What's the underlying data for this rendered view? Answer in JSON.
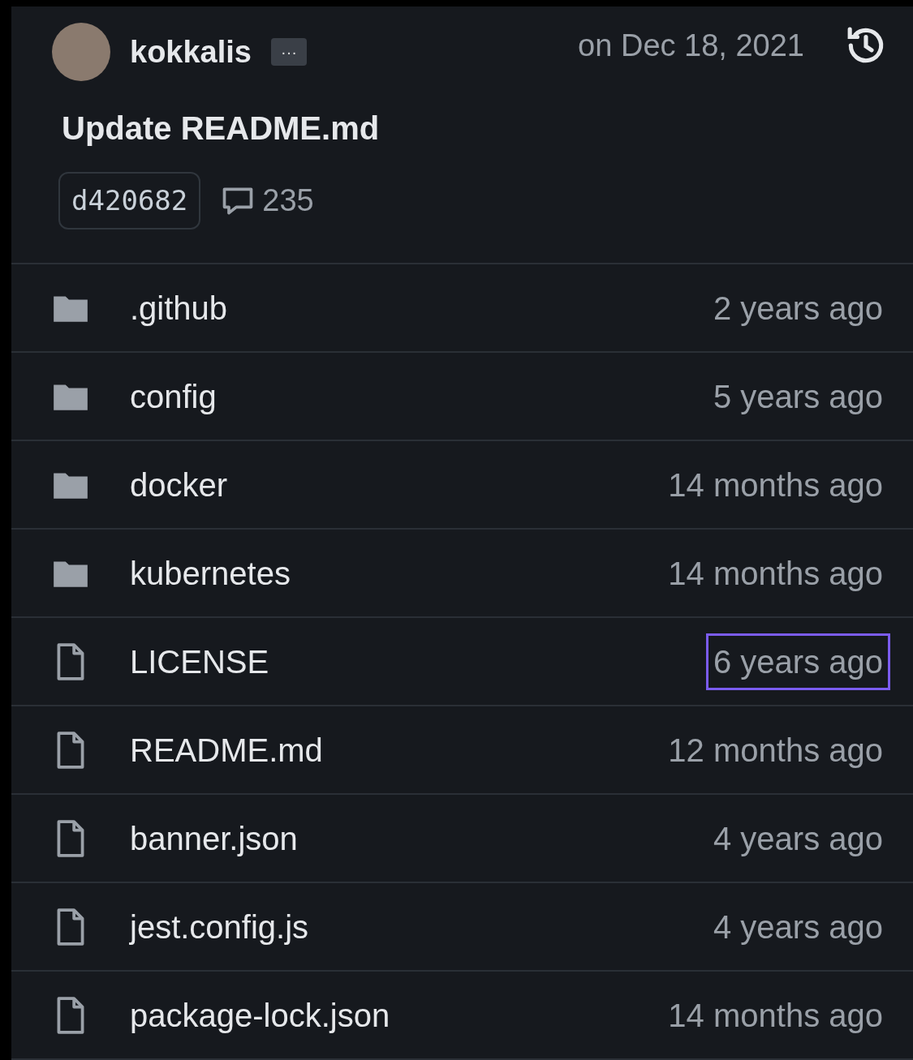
{
  "commit": {
    "author": "kokkalis",
    "more": "···",
    "date": "on Dec 18, 2021",
    "message": "Update README.md",
    "sha": "d420682",
    "comments": "235"
  },
  "files": [
    {
      "kind": "folder",
      "name": ".github",
      "age": "2 years ago",
      "highlighted": false
    },
    {
      "kind": "folder",
      "name": "config",
      "age": "5 years ago",
      "highlighted": false
    },
    {
      "kind": "folder",
      "name": "docker",
      "age": "14 months ago",
      "highlighted": false
    },
    {
      "kind": "folder",
      "name": "kubernetes",
      "age": "14 months ago",
      "highlighted": false
    },
    {
      "kind": "file",
      "name": "LICENSE",
      "age": "6 years ago",
      "highlighted": true
    },
    {
      "kind": "file",
      "name": "README.md",
      "age": "12 months ago",
      "highlighted": false
    },
    {
      "kind": "file",
      "name": "banner.json",
      "age": "4 years ago",
      "highlighted": false
    },
    {
      "kind": "file",
      "name": "jest.config.js",
      "age": "4 years ago",
      "highlighted": false
    },
    {
      "kind": "file",
      "name": "package-lock.json",
      "age": "14 months ago",
      "highlighted": false
    }
  ]
}
